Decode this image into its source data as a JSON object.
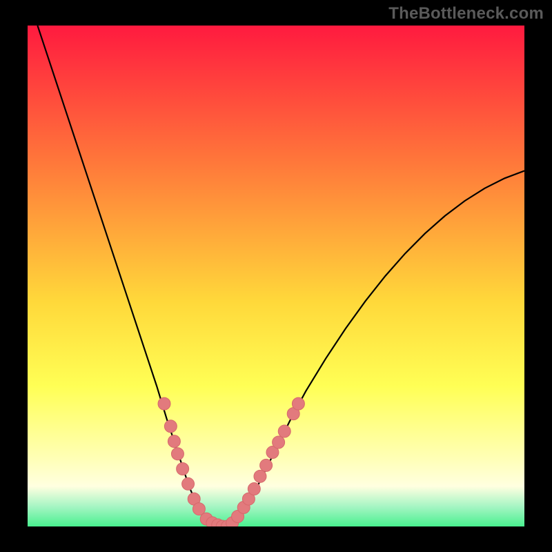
{
  "watermark": "TheBottleneck.com",
  "colors": {
    "bg_black": "#000000",
    "grad_top": "#ff1a3f",
    "grad_mid1": "#ff7a3a",
    "grad_mid2": "#ffd83a",
    "grad_mid3": "#ffff55",
    "grad_paleyellow": "#ffffb3",
    "grad_mint": "#49f08f",
    "curve": "#000000",
    "marker_fill": "#e27a7d",
    "marker_stroke": "#d6686b"
  },
  "chart_data": {
    "type": "line",
    "title": "",
    "xlabel": "",
    "ylabel": "",
    "xlim": [
      0,
      100
    ],
    "ylim": [
      0,
      100
    ],
    "curve": {
      "x": [
        2,
        4,
        6,
        8,
        10,
        12,
        14,
        16,
        18,
        20,
        22,
        24,
        26,
        28,
        29.5,
        31,
        32.5,
        34,
        35.5,
        37,
        39,
        40,
        41,
        42,
        44,
        46,
        48,
        50,
        53,
        56,
        60,
        64,
        68,
        72,
        76,
        80,
        84,
        88,
        92,
        96,
        100
      ],
      "y": [
        100,
        94,
        88,
        82,
        76,
        70,
        64,
        58,
        52,
        46,
        40,
        34,
        28,
        21.5,
        17,
        12.5,
        8,
        4.5,
        2,
        0.7,
        0,
        0,
        0.5,
        1.5,
        4,
        7.5,
        11.5,
        15.5,
        21.5,
        27,
        33.5,
        39.5,
        45,
        50,
        54.5,
        58.5,
        62,
        65,
        67.5,
        69.5,
        71
      ]
    },
    "markers": [
      {
        "x": 27.5,
        "y": 24.5
      },
      {
        "x": 28.8,
        "y": 20.0
      },
      {
        "x": 29.5,
        "y": 17.0
      },
      {
        "x": 30.2,
        "y": 14.5
      },
      {
        "x": 31.2,
        "y": 11.5
      },
      {
        "x": 32.3,
        "y": 8.5
      },
      {
        "x": 33.5,
        "y": 5.5
      },
      {
        "x": 34.5,
        "y": 3.5
      },
      {
        "x": 36.0,
        "y": 1.5
      },
      {
        "x": 37.2,
        "y": 0.7
      },
      {
        "x": 38.3,
        "y": 0.3
      },
      {
        "x": 39.2,
        "y": 0.0
      },
      {
        "x": 40.2,
        "y": 0.0
      },
      {
        "x": 41.2,
        "y": 0.7
      },
      {
        "x": 42.3,
        "y": 2.0
      },
      {
        "x": 43.5,
        "y": 3.8
      },
      {
        "x": 44.5,
        "y": 5.5
      },
      {
        "x": 45.6,
        "y": 7.5
      },
      {
        "x": 46.8,
        "y": 10.0
      },
      {
        "x": 48.0,
        "y": 12.2
      },
      {
        "x": 49.3,
        "y": 14.8
      },
      {
        "x": 50.5,
        "y": 16.8
      },
      {
        "x": 51.7,
        "y": 19.0
      },
      {
        "x": 53.5,
        "y": 22.5
      },
      {
        "x": 54.5,
        "y": 24.5
      }
    ]
  }
}
